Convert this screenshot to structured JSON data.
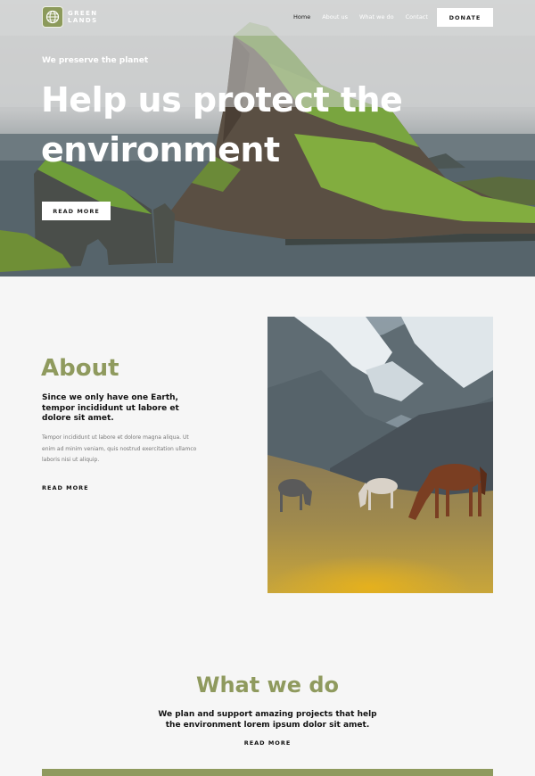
{
  "brand": {
    "name_line1": "GREEN",
    "name_line2": "LANDS",
    "accent_color": "#8f9a5e"
  },
  "nav": {
    "items": [
      {
        "label": "Home",
        "active": true
      },
      {
        "label": "About us",
        "active": false
      },
      {
        "label": "What we do",
        "active": false
      },
      {
        "label": "Contact",
        "active": false
      }
    ],
    "donate_label": "DONATE"
  },
  "hero": {
    "eyebrow": "We preserve the planet",
    "title_line1": "Help us protect the",
    "title_line2": "environment",
    "button_label": "READ MORE"
  },
  "about": {
    "title": "About",
    "lead": "Since we only have one Earth, tempor incididunt ut labore et dolore sit amet.",
    "body": "Tempor incididunt ut labore et dolore magna aliqua. Ut enim ad minim veniam, quis nostrud exercitation ullamco laboris nisi ut aliquip.",
    "link_label": "READ MORE"
  },
  "what_we_do": {
    "title": "What we do",
    "lead": "We plan and support amazing projects that help the environment lorem ipsum dolor sit amet.",
    "link_label": "READ MORE"
  }
}
